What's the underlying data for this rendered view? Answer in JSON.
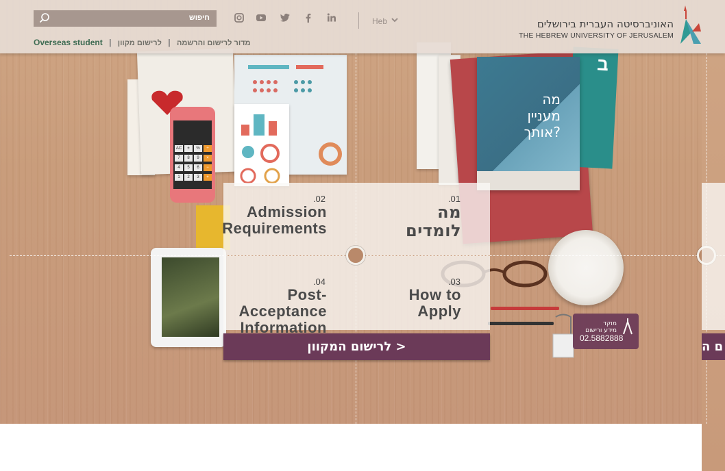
{
  "header": {
    "search": {
      "placeholder": "חיפוש"
    },
    "social": [
      "instagram-icon",
      "youtube-icon",
      "twitter-icon",
      "facebook-icon",
      "linkedin-icon"
    ],
    "language": "Heb",
    "logo": {
      "hebrew": "האוניברסיטה העברית בירושלים",
      "english": "THE HEBREW UNIVERSITY OF JERUSALEM"
    },
    "nav": {
      "overseas": "Overseas student",
      "online_registration": "לרישום מקוון",
      "registration_guide": "מדור לרישום והרשמה"
    }
  },
  "book_cover": {
    "title_line1": "מה",
    "title_line2": "מעניין",
    "title_line3": "אותך?"
  },
  "book_teal": {
    "letter": "ב"
  },
  "tiles": [
    {
      "number": ".01",
      "title_line1": "מה",
      "title_line2": "לומדים"
    },
    {
      "number": ".02",
      "title_line1": "Admission",
      "title_line2": "Requirements"
    },
    {
      "number": ".03",
      "title_line1": "How to",
      "title_line2": "Apply"
    },
    {
      "number": ".04",
      "title_line1": "Post-Acceptance",
      "title_line2": "Information"
    }
  ],
  "register_button": {
    "label": "לרישום המקוון >"
  },
  "register_peek": {
    "label": "ם ה"
  },
  "info_badge": {
    "line1": "מוקד",
    "line2": "מידע ורישום",
    "phone": "02.5882888"
  },
  "colors": {
    "accent": "#6b3a58",
    "nav_green": "#3d6b52",
    "header_bg": "#e6dcd4"
  }
}
